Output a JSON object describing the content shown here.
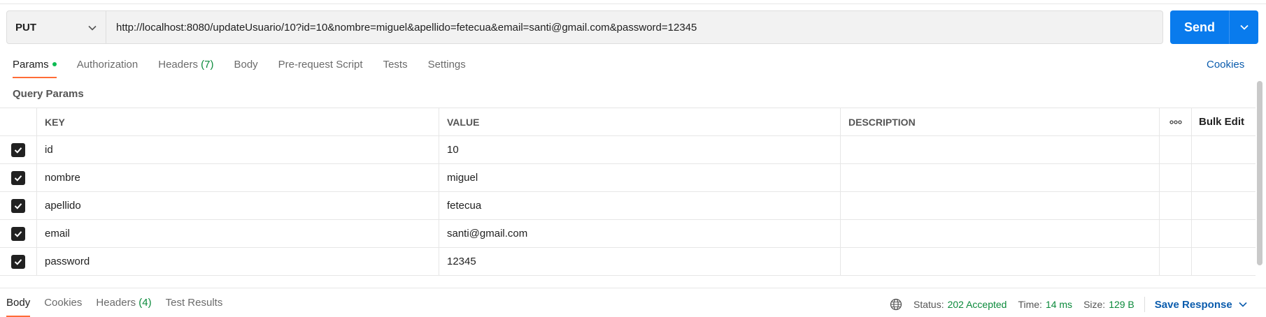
{
  "request": {
    "method": "PUT",
    "url": "http://localhost:8080/updateUsuario/10?id=10&nombre=miguel&apellido=fetecua&email=santi@gmail.com&password=12345",
    "send_label": "Send"
  },
  "tabs": [
    {
      "label": "Params",
      "active": true
    },
    {
      "label": "Authorization"
    },
    {
      "label": "Headers ",
      "count": "(7)"
    },
    {
      "label": "Body"
    },
    {
      "label": "Pre-request Script"
    },
    {
      "label": "Tests"
    },
    {
      "label": "Settings"
    }
  ],
  "cookies_label": "Cookies",
  "query_params_title": "Query Params",
  "table": {
    "headers": {
      "key": "KEY",
      "value": "VALUE",
      "description": "DESCRIPTION",
      "bulk_edit": "Bulk Edit"
    },
    "rows": [
      {
        "key": "id",
        "value": "10",
        "description": ""
      },
      {
        "key": "nombre",
        "value": "miguel",
        "description": ""
      },
      {
        "key": "apellido",
        "value": "fetecua",
        "description": ""
      },
      {
        "key": "email",
        "value": "santi@gmail.com",
        "description": ""
      },
      {
        "key": "password",
        "value": "12345",
        "description": ""
      }
    ]
  },
  "response": {
    "tabs": [
      {
        "label": "Body",
        "active": true
      },
      {
        "label": "Cookies"
      },
      {
        "label": "Headers ",
        "count": "(4)"
      },
      {
        "label": "Test Results"
      }
    ],
    "status_label": "Status:",
    "status_value": "202 Accepted",
    "time_label": "Time:",
    "time_value": "14 ms",
    "size_label": "Size:",
    "size_value": "129 B",
    "save_label": "Save Response"
  },
  "colors": {
    "accent": "#ff6c37",
    "send": "#097bed",
    "link": "#0b5cad",
    "success": "#0b8a3b"
  },
  "icons": [
    "chevron-down-icon",
    "check-icon",
    "more-horizontal-icon",
    "globe-icon"
  ]
}
